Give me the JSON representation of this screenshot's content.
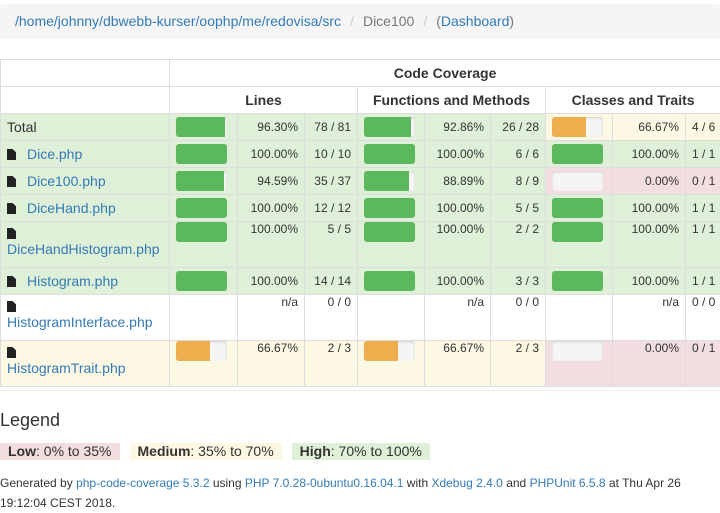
{
  "breadcrumb": {
    "path": "/home/johnny/dbwebb-kurser/oophp/me/redovisa/src",
    "current": "Dice100",
    "dashboard_open": "(",
    "dashboard": "Dashboard",
    "dashboard_close": ")"
  },
  "header": {
    "coverage": "Code Coverage",
    "lines": "Lines",
    "functions": "Functions and Methods",
    "classes": "Classes and Traits"
  },
  "rows": [
    {
      "name": "Total",
      "file": false,
      "lines_pct": 96.3,
      "lines_pct_text": "96.30%",
      "lines_count": "78 / 81",
      "func_pct": 92.86,
      "func_pct_text": "92.86%",
      "func_count": "26 / 28",
      "cls_pct": 66.67,
      "cls_pct_text": "66.67%",
      "cls_count": "4 / 6"
    },
    {
      "name": "Dice.php",
      "file": true,
      "lines_pct": 100,
      "lines_pct_text": "100.00%",
      "lines_count": "10 / 10",
      "func_pct": 100,
      "func_pct_text": "100.00%",
      "func_count": "6 / 6",
      "cls_pct": 100,
      "cls_pct_text": "100.00%",
      "cls_count": "1 / 1"
    },
    {
      "name": "Dice100.php",
      "file": true,
      "lines_pct": 94.59,
      "lines_pct_text": "94.59%",
      "lines_count": "35 / 37",
      "func_pct": 88.89,
      "func_pct_text": "88.89%",
      "func_count": "8 / 9",
      "cls_pct": 0,
      "cls_pct_text": "0.00%",
      "cls_count": "0 / 1"
    },
    {
      "name": "DiceHand.php",
      "file": true,
      "lines_pct": 100,
      "lines_pct_text": "100.00%",
      "lines_count": "12 / 12",
      "func_pct": 100,
      "func_pct_text": "100.00%",
      "func_count": "5 / 5",
      "cls_pct": 100,
      "cls_pct_text": "100.00%",
      "cls_count": "1 / 1"
    },
    {
      "name": "DiceHandHistogram.php",
      "file": true,
      "lines_pct": 100,
      "lines_pct_text": "100.00%",
      "lines_count": "5 / 5",
      "func_pct": 100,
      "func_pct_text": "100.00%",
      "func_count": "2 / 2",
      "cls_pct": 100,
      "cls_pct_text": "100.00%",
      "cls_count": "1 / 1"
    },
    {
      "name": "Histogram.php",
      "file": true,
      "lines_pct": 100,
      "lines_pct_text": "100.00%",
      "lines_count": "14 / 14",
      "func_pct": 100,
      "func_pct_text": "100.00%",
      "func_count": "3 / 3",
      "cls_pct": 100,
      "cls_pct_text": "100.00%",
      "cls_count": "1 / 1"
    },
    {
      "name": "HistogramInterface.php",
      "file": true,
      "lines_pct": null,
      "lines_pct_text": "n/a",
      "lines_count": "0 / 0",
      "func_pct": null,
      "func_pct_text": "n/a",
      "func_count": "0 / 0",
      "cls_pct": null,
      "cls_pct_text": "n/a",
      "cls_count": "0 / 0"
    },
    {
      "name": "HistogramTrait.php",
      "file": true,
      "lines_pct": 66.67,
      "lines_pct_text": "66.67%",
      "lines_count": "2 / 3",
      "func_pct": 66.67,
      "func_pct_text": "66.67%",
      "func_count": "2 / 3",
      "cls_pct": 0,
      "cls_pct_text": "0.00%",
      "cls_count": "0 / 1"
    }
  ],
  "legend": {
    "title": "Legend",
    "low_label": "Low",
    "low_range": ": 0% to 35%",
    "medium_label": "Medium",
    "medium_range": ": 35% to 70%",
    "high_label": "High",
    "high_range": ": 70% to 100%"
  },
  "footer": {
    "t1": "Generated by ",
    "l1": "php-code-coverage 5.3.2",
    "t2": " using ",
    "l2": "PHP 7.0.28-0ubuntu0.16.04.1",
    "t3": " with ",
    "l3": "Xdebug 2.4.0",
    "t4": " and ",
    "l4": "PHPUnit 6.5.8",
    "t5": " at Thu Apr 26 19:12:04 CEST 2018."
  },
  "colors": {
    "success_bg": "#dff0d8",
    "warning_bg": "#fcf8e3",
    "danger_bg": "#f2dede",
    "success_bar": "#5cb85c",
    "warning_bar": "#f0ad4e",
    "link": "#337ab7"
  }
}
